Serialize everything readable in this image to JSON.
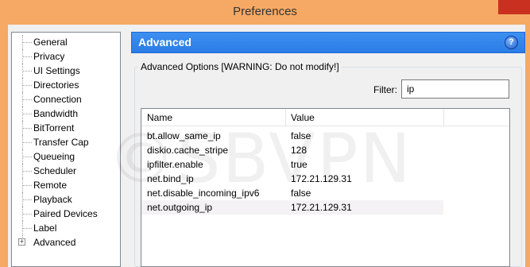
{
  "window": {
    "title": "Preferences"
  },
  "tree": {
    "items": [
      {
        "label": "General"
      },
      {
        "label": "Privacy"
      },
      {
        "label": "UI Settings"
      },
      {
        "label": "Directories"
      },
      {
        "label": "Connection"
      },
      {
        "label": "Bandwidth"
      },
      {
        "label": "BitTorrent"
      },
      {
        "label": "Transfer Cap"
      },
      {
        "label": "Queueing"
      },
      {
        "label": "Scheduler"
      },
      {
        "label": "Remote"
      },
      {
        "label": "Playback"
      },
      {
        "label": "Paired Devices"
      },
      {
        "label": "Label"
      },
      {
        "label": "Advanced",
        "expander": "+"
      }
    ]
  },
  "panel": {
    "title": "Advanced",
    "help_icon": "?",
    "group_title": "Advanced Options [WARNING: Do not modify!]",
    "filter_label": "Filter:",
    "filter_value": "ip",
    "columns": {
      "name": "Name",
      "value": "Value"
    },
    "rows": [
      {
        "name": "bt.allow_same_ip",
        "value": "false"
      },
      {
        "name": "diskio.cache_stripe",
        "value": "128"
      },
      {
        "name": "ipfilter.enable",
        "value": "true"
      },
      {
        "name": "net.bind_ip",
        "value": "172.21.129.31"
      },
      {
        "name": "net.disable_incoming_ipv6",
        "value": "false"
      },
      {
        "name": "net.outgoing_ip",
        "value": "172.21.129.31"
      }
    ]
  },
  "watermark": "©SBVPN"
}
